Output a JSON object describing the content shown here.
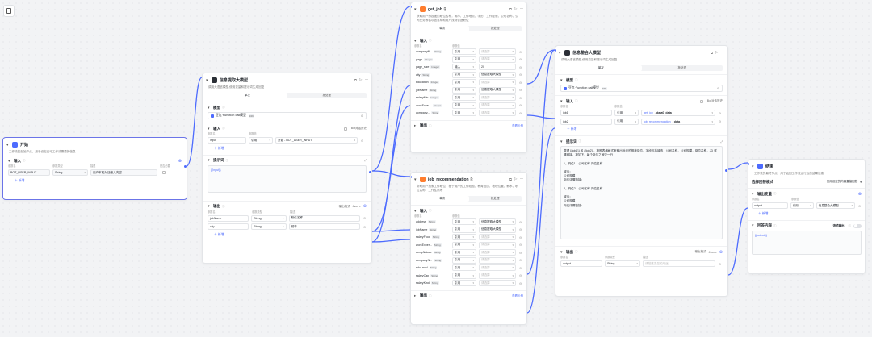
{
  "canvas": {
    "bg": "#f2f3f5",
    "accent": "#4d6bfe",
    "selected_border": "#6b74e8",
    "doc_icon": "document-icon"
  },
  "common": {
    "input_label": "输入",
    "output_label": "输出",
    "model_label": "模型",
    "prompt_label": "提示词",
    "add_label": "新增",
    "col_name": "参数名",
    "col_type": "参数类型",
    "col_value": "参数值",
    "col_desc": "描述",
    "col_required": "是否必要",
    "col_value_short": "参数值",
    "output_format": "输出格式",
    "json": "Json",
    "ref": "引用",
    "input_val": "输入",
    "tab_single": "单次",
    "tab_batch": "批处理",
    "placeholder_select": "请选择",
    "placeholder_input": "请输入",
    "view_example": "查看示例",
    "string": "String",
    "integer": "Integer",
    "batch_label": "批处理",
    "intent_setting": "意图设置"
  },
  "start": {
    "title": "开始",
    "desc": "工作流的起始节点，用于设定启动工作流需要的信息",
    "input_title": "输入",
    "param": {
      "name": "BOT_USER_INPUT",
      "type": "String",
      "desc": "用户本轮对话输入内容"
    }
  },
  "intent_llm": {
    "title": "信息提取大模型",
    "desc": "调用大语言模型,使用变量和提示词生成回复",
    "model_name": "豆包·Function call模型",
    "model_tag": "32K",
    "batch_history": "Bot对话历史",
    "input_name": "input",
    "input_ref": "引用",
    "input_value": "开始 - BOT_USER_INPUT",
    "prompt_text": "{{input}}",
    "outputs": [
      {
        "name": "jobName",
        "type": "String",
        "desc": "职位名称"
      },
      {
        "name": "city",
        "type": "String",
        "desc": "城市"
      }
    ]
  },
  "get_job": {
    "title": "get_job",
    "desc": "获取用户想投递的职位名称，城市，工作地点，学历，工作经验，公司名称，公司业务等各项信息帮助用户找到合适职位",
    "params": [
      {
        "name": "companyN...",
        "type": "String",
        "mode": "引用",
        "value": "请选择"
      },
      {
        "name": "page",
        "type": "Integer",
        "mode": "引用",
        "value": "请选择"
      },
      {
        "name": "page_size",
        "type": "Integer",
        "mode": "输入",
        "value": "20"
      },
      {
        "name": "city",
        "type": "String",
        "mode": "引用",
        "value": "信息提取大模型"
      },
      {
        "name": "education",
        "type": "Integer",
        "mode": "引用",
        "value": "请选择"
      },
      {
        "name": "jobName",
        "type": "String",
        "mode": "引用",
        "value": "信息提取大模型"
      },
      {
        "name": "salaryMin",
        "type": "Integer",
        "mode": "引用",
        "value": "请选择"
      },
      {
        "name": "workExpe...",
        "type": "Integer",
        "mode": "引用",
        "value": "请选择"
      },
      {
        "name": "company...",
        "type": "String",
        "mode": "引用",
        "value": "请选择"
      }
    ],
    "output_label": "输出"
  },
  "job_rec": {
    "title": "job_recommendation",
    "desc": "帮助用户搜索工作职位，基于用户的工作经验，教育经历，地理位置，薪水，职位名称，工作性质等",
    "params": [
      {
        "name": "address",
        "type": "String",
        "mode": "引用",
        "value": "信息提取大模型"
      },
      {
        "name": "jobName",
        "type": "String",
        "mode": "引用",
        "value": "信息提取大模型"
      },
      {
        "name": "salaryFloor",
        "type": "String",
        "mode": "引用",
        "value": "请选择"
      },
      {
        "name": "workExper...",
        "type": "String",
        "mode": "引用",
        "value": "请选择"
      },
      {
        "name": "compNature",
        "type": "String",
        "mode": "引用",
        "value": "请选择"
      },
      {
        "name": "companyN...",
        "type": "String",
        "mode": "引用",
        "value": "请选择"
      },
      {
        "name": "eduLevel",
        "type": "String",
        "mode": "引用",
        "value": "请选择"
      },
      {
        "name": "salaryCap",
        "type": "String",
        "mode": "引用",
        "value": "请选择"
      },
      {
        "name": "salaryKind",
        "type": "String",
        "mode": "引用",
        "value": "请选择"
      }
    ],
    "output_label": "输出"
  },
  "summary_llm": {
    "title": "信息整合大模型",
    "desc": "调用大语言模型,使用变量和提示词生成回复",
    "model_name": "豆包·Function call模型",
    "model_tag": "32K",
    "inputs": [
      {
        "name": "job1",
        "mode": "引用",
        "src": "get_job",
        "field": "data0_data"
      },
      {
        "name": "job2",
        "mode": "引用",
        "src": "job_recommendation",
        "field": "data"
      }
    ],
    "prompt_lines": [
      "整理 {{job1}} 和 {{job2}}，按照表格格式来输出对应的推荐岗位，字段包括城市，公司名称，公司规模，岗位名称，JD 详情链接，按如下，每个岗位之间空一行",
      "",
      "1、岗位1：公司名称-岗位名称",
      "",
      "城市：",
      "公司规模：",
      "岗位详情链接：",
      "",
      "2、岗位2：公司名称-岗位名称",
      "",
      "城市：",
      "公司规模：",
      "岗位详情链接："
    ],
    "output": {
      "name": "output",
      "type": "String",
      "desc_placeholder": "请描述变量的用途"
    }
  },
  "end": {
    "title": "结束",
    "desc": "工作流的最终节点，用于返回工作流运行后的结果信息",
    "mode_label": "选择回答模式",
    "mode_value": "使用设定的内容直接回答",
    "output_var_label": "输出变量",
    "var": {
      "name": "output",
      "mode": "引用",
      "value": "信息整合大模型"
    },
    "answer_label": "回答内容",
    "stream_label": "流式输出",
    "answer_value": "{{output}}"
  }
}
